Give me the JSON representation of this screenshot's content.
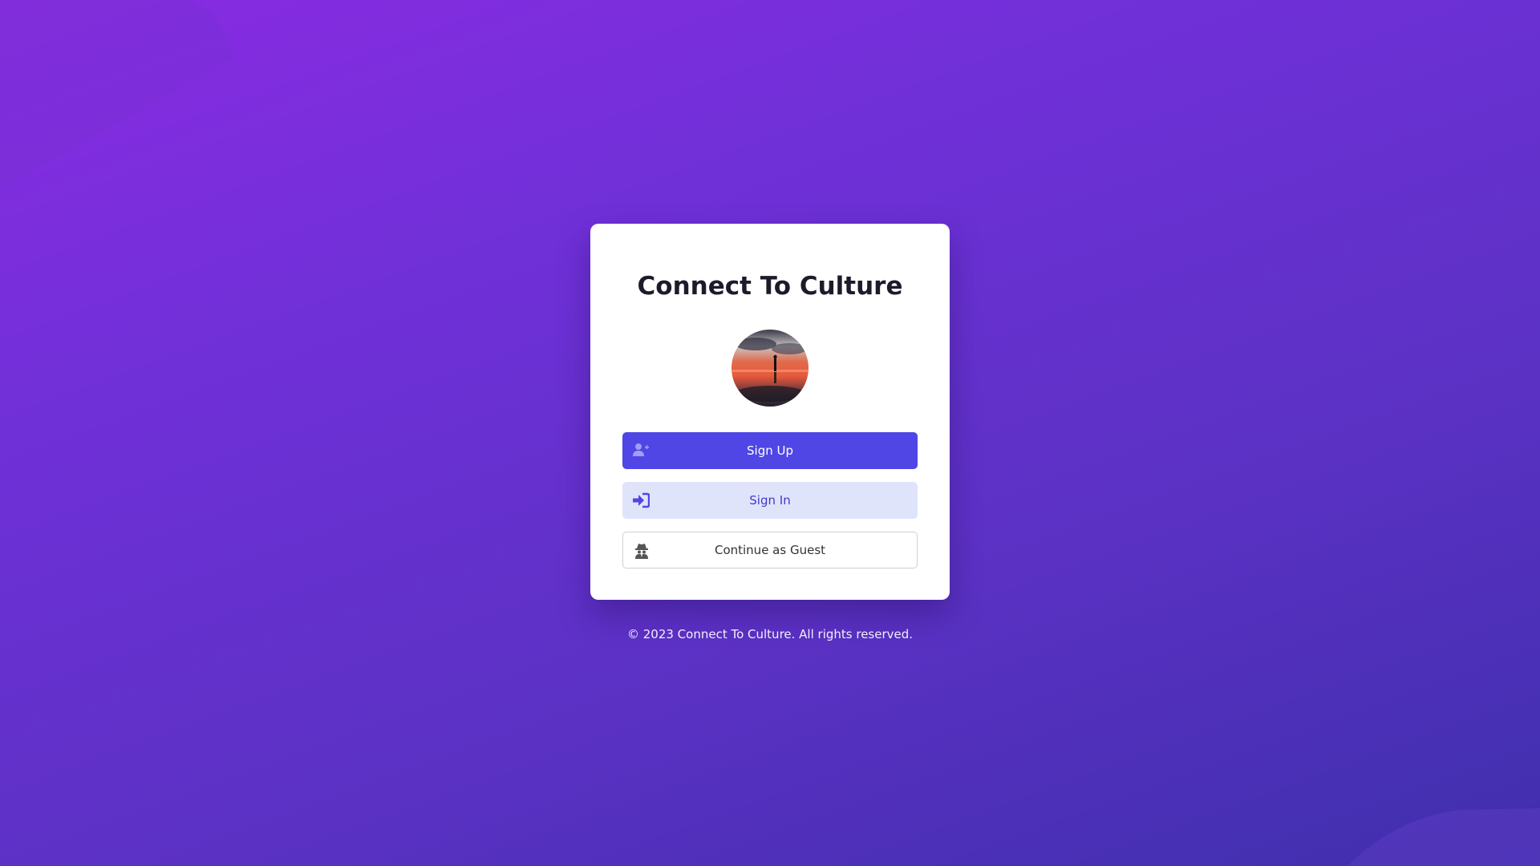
{
  "app": {
    "title": "Connect To Culture"
  },
  "auth": {
    "signup_label": "Sign Up",
    "signin_label": "Sign In",
    "guest_label": "Continue as Guest"
  },
  "icons": {
    "signup": "user-plus-icon",
    "signin": "sign-in-icon",
    "guest": "user-secret-icon"
  },
  "footer": {
    "copyright": "© 2023 Connect To Culture. All rights reserved."
  },
  "colors": {
    "background_start": "#8a2be2",
    "background_end": "#3f2fad",
    "primary": "#4f46e5",
    "secondary_bg": "#e0e4fb",
    "secondary_text": "#4338ca"
  }
}
